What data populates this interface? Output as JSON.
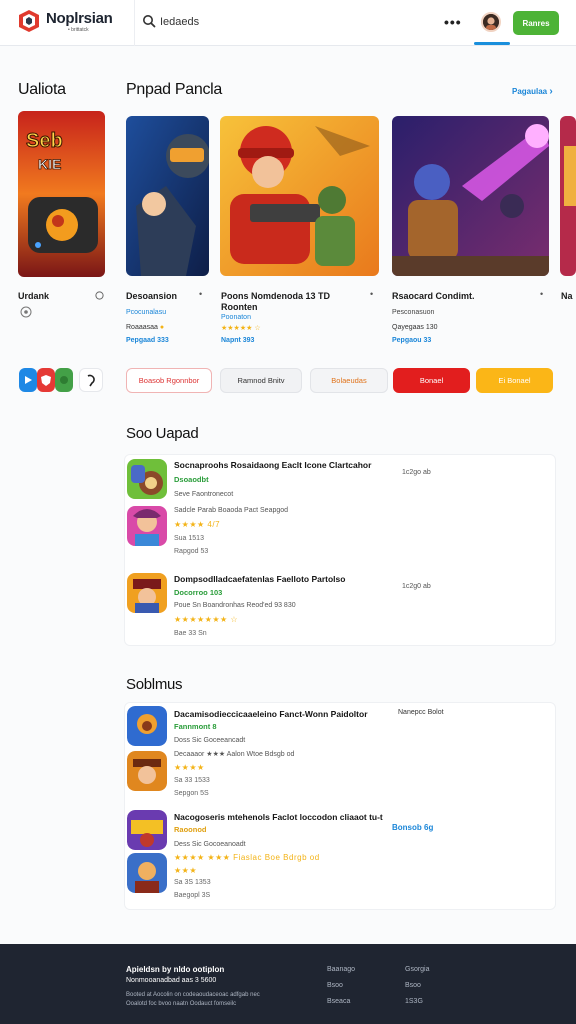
{
  "header": {
    "brand": "Noplrsian",
    "brand_sub": "• brittatck",
    "search_value": "Iedaeds",
    "more_icon": "more-dots-icon",
    "get_button": "Ranres"
  },
  "featured": {
    "side_title": "Ualiota",
    "title": "Pnpad Pancla",
    "see_all": "Pagaulaa",
    "side_card": {
      "name": "Urdank",
      "rating_icon": "info-icon"
    },
    "cards": [
      {
        "name": "Desoansion",
        "dot": "•",
        "publisher": "Pcocunalasu",
        "rating": "Roaaasaa",
        "price": "Pepgaad 333"
      },
      {
        "name": "Poons Nomdenoda 1​3 TD Roonten",
        "dot": "•",
        "publisher": "Poonaton",
        "rating": "★★★★★ ☆",
        "price": "Napnt 393"
      },
      {
        "name": "Rsaocard Condimt.",
        "dot": "•",
        "publisher": "Pesconasuon",
        "rating": "Qayegaas 130",
        "price": "Pepgaou 33"
      },
      {
        "name": "Na",
        "dot": "",
        "publisher": "",
        "rating": "",
        "price": ""
      }
    ]
  },
  "filters": {
    "platforms": [
      "playstore-icon",
      "shield-icon",
      "xbox-icon",
      "steam-icon"
    ],
    "pills": [
      {
        "label": "Boasob Rgonnbor",
        "style": "outline-red"
      },
      {
        "label": "Ramnod Bnitv",
        "style": "gray"
      },
      {
        "label": "Bolaeudas",
        "style": "outline-orange"
      },
      {
        "label": "Bonael",
        "style": "red"
      },
      {
        "label": "Ei Bonael",
        "style": "yellow"
      }
    ]
  },
  "section1": {
    "title": "Soo Uapad",
    "items": [
      {
        "title": "Socnaproohs Rosaidaong Eaclt Icone Clartcahor",
        "time": "1c2go ab",
        "sub": "Dsoaodbt",
        "meta": "Seve Faontronecot",
        "stars": "",
        "size": ""
      },
      {
        "title": "",
        "time": "",
        "sub": "",
        "meta": "Sadcle Parab Boaoda Pact Seapgod",
        "stars": "★★★★ 4/7",
        "size": "Sua 1513"
      },
      {
        "title": "",
        "time": "",
        "sub": "",
        "meta": "",
        "stars": "",
        "size": "Rapgod 53"
      },
      {
        "title": "Dompsodlladcaefatenlas Faelloto Partolso",
        "time": "1c2g0 ab",
        "sub": "Docorroo 103",
        "meta": "Poue Sn Boandronhas Reod'ed 93 830",
        "stars": "★★★★★★★ ☆",
        "size": "Bae 33 Sn"
      }
    ]
  },
  "section2": {
    "title": "Soblmus",
    "items": [
      {
        "title": "Dacamisodieccicaaeleino Fanct-Wonn Paidoltor",
        "price": "Nanepcc Bolot",
        "sub": "Fannmont 8",
        "meta": "Doss Sic Goceeancadt",
        "stars": "Decaaaor ★★★ Aalon Wtoe Bdsgb od",
        "size": ""
      },
      {
        "title": "",
        "price": "",
        "sub": "",
        "meta": "",
        "stars": "★★★★",
        "size": "Sa 33 1533"
      },
      {
        "title": "",
        "price": "",
        "sub": "",
        "meta": "",
        "stars": "",
        "size": "Sepgon 5S"
      },
      {
        "title": "Nacogoseris mtehenols Faclot loccodon cliaaot tu-t",
        "price": "Bonsob 6g",
        "sub": "Raoonod",
        "meta": "Dess Sic Gocoeanoadt",
        "stars": "★★★★ ★★★ Fiaslac Boe Bdrgb od",
        "size": ""
      },
      {
        "title": "",
        "price": "",
        "sub": "",
        "meta": "",
        "stars": "★★★",
        "size": "Sa 3S 1353"
      },
      {
        "title": "",
        "price": "",
        "sub": "",
        "meta": "",
        "stars": "",
        "size": "Baegopl 3S"
      }
    ]
  },
  "footer": {
    "heading": "Apieldsn by nldo ootiplon",
    "sub": "Nonmooanadbad aas 3 5600",
    "small1": "Booted at Aocolin on codeaoudaceoac adfgab nec",
    "small2": "Ooalotd foc bvoo naatn Oodauct fomseilc",
    "col1": [
      "Baanago",
      "Bsoo",
      "Bseaca"
    ],
    "col2": [
      "Gsorgia",
      "Bsoo",
      "1S3G"
    ]
  },
  "colors": {
    "accent": "#1b86d8",
    "brand_green": "#4db336",
    "footer_bg": "#1f2531"
  }
}
